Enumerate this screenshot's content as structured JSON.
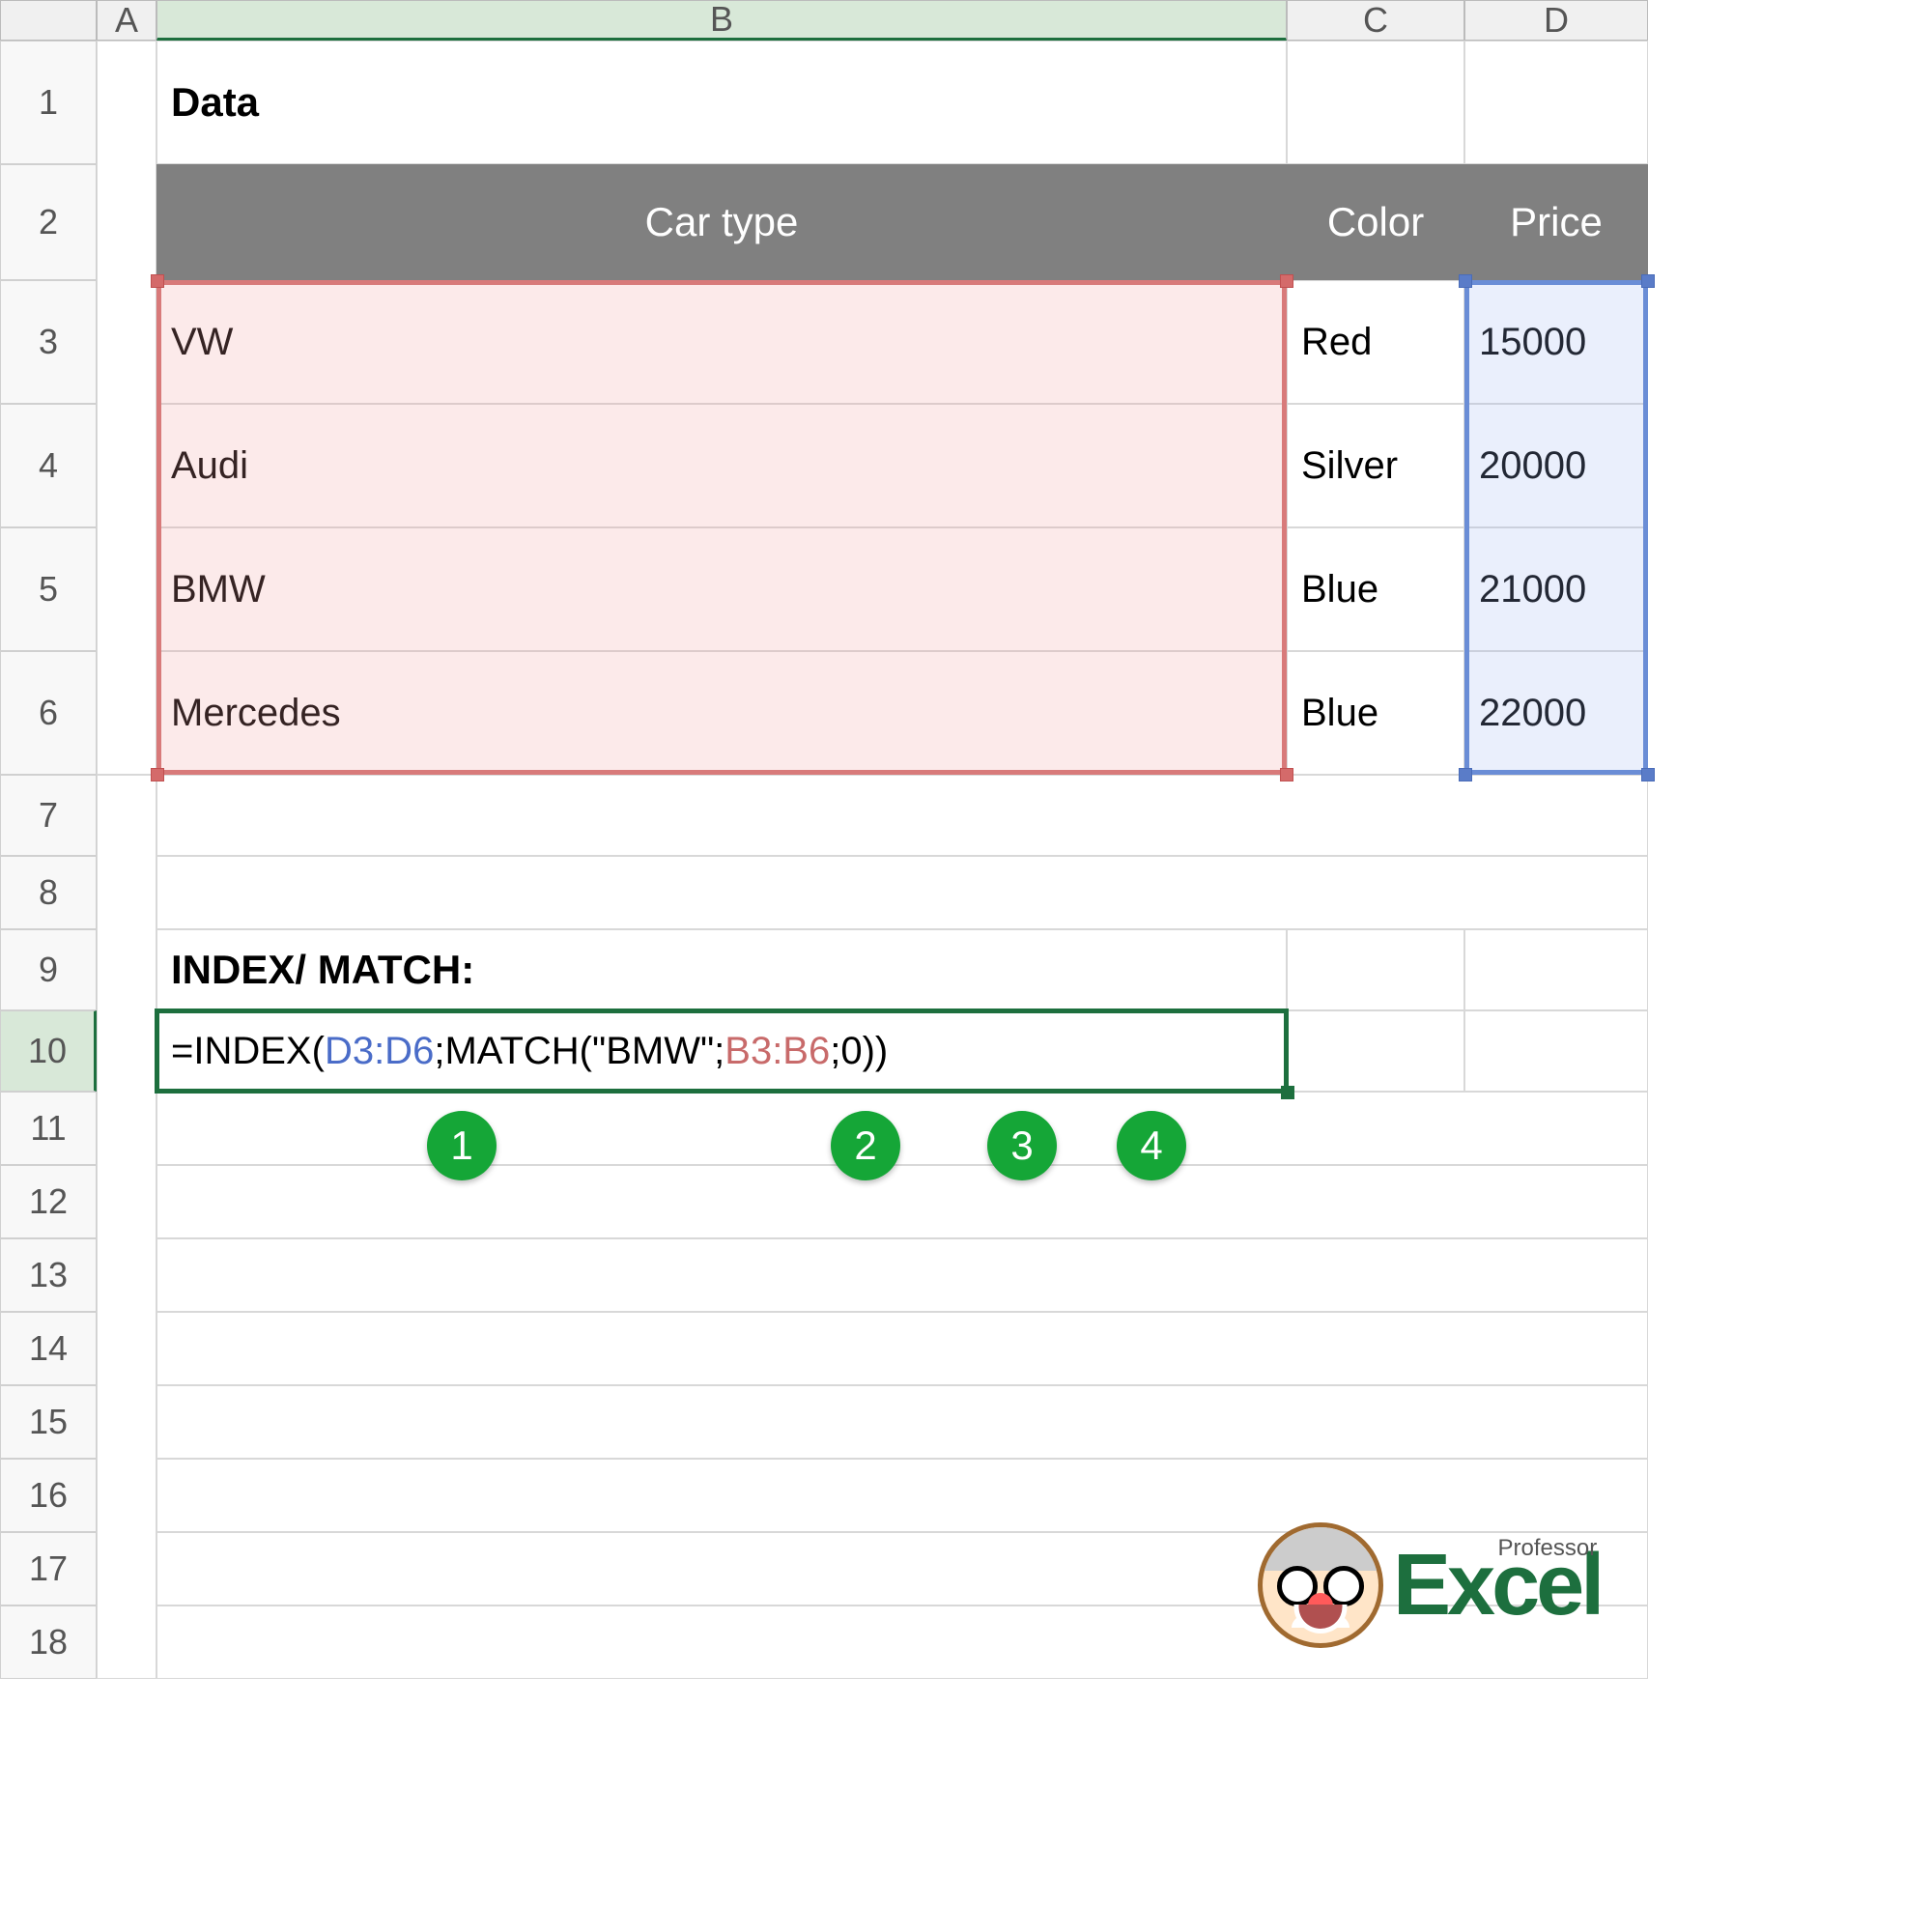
{
  "columns": {
    "A": "A",
    "B": "B",
    "C": "C",
    "D": "D"
  },
  "rows": [
    "1",
    "2",
    "3",
    "4",
    "5",
    "6",
    "7",
    "8",
    "9",
    "10",
    "11",
    "12",
    "13",
    "14",
    "15",
    "16",
    "17",
    "18"
  ],
  "B1": "Data",
  "headers": {
    "B2": "Car type",
    "C2": "Color",
    "D2": "Price"
  },
  "data": [
    {
      "b": "VW",
      "c": "Red",
      "d": "15000"
    },
    {
      "b": "Audi",
      "c": "Silver",
      "d": "20000"
    },
    {
      "b": "BMW",
      "c": "Blue",
      "d": "21000"
    },
    {
      "b": "Mercedes",
      "c": "Blue",
      "d": "22000"
    }
  ],
  "B9": "INDEX/ MATCH:",
  "formula": {
    "p1": "=INDEX(",
    "ref1": "D3:D6",
    "p2": ";MATCH(\"BMW\";",
    "ref2": "B3:B6",
    "p3": ";0))"
  },
  "badges": [
    "1",
    "2",
    "3",
    "4"
  ],
  "logo": {
    "small": "Professor",
    "big": "Excel"
  }
}
